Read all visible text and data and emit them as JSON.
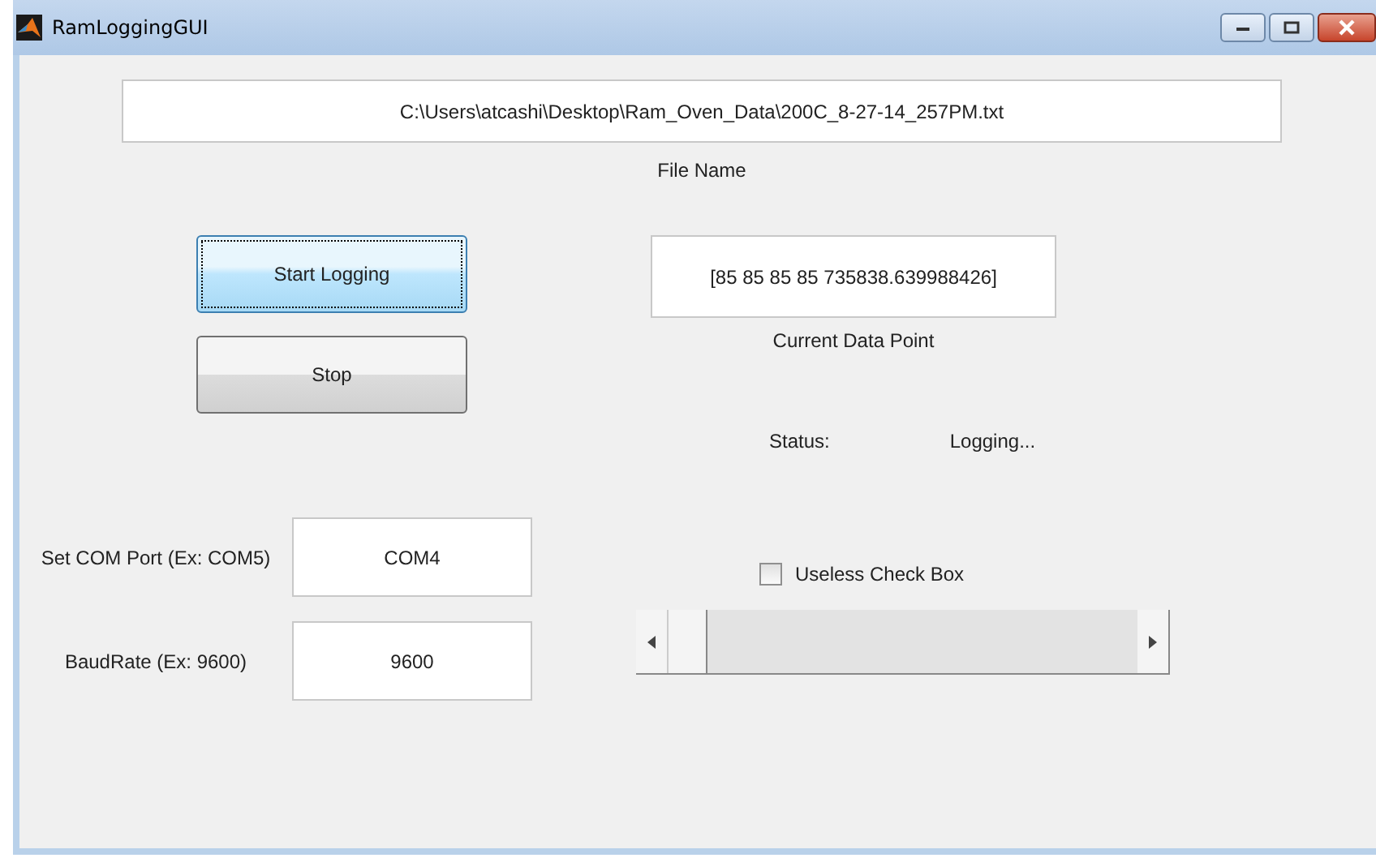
{
  "window": {
    "title": "RamLoggingGUI"
  },
  "file_name": {
    "value": "C:\\Users\\atcashi\\Desktop\\Ram_Oven_Data\\200C_8-27-14_257PM.txt",
    "label": "File Name"
  },
  "buttons": [
    {
      "label": "Start Logging",
      "focused": true
    },
    {
      "label": "Stop",
      "focused": false
    }
  ],
  "current_data_point": {
    "value": "[85 85 85 85 735838.639988426]",
    "label": "Current Data Point"
  },
  "status": {
    "label": "Status:",
    "value": "Logging..."
  },
  "com_port": {
    "label": "Set COM Port (Ex: COM5)",
    "value": "COM4"
  },
  "baud_rate": {
    "label": "BaudRate (Ex: 9600)",
    "value": "9600"
  },
  "checkbox": {
    "label": "Useless Check Box",
    "checked": false
  },
  "slider": {
    "level": 0
  }
}
